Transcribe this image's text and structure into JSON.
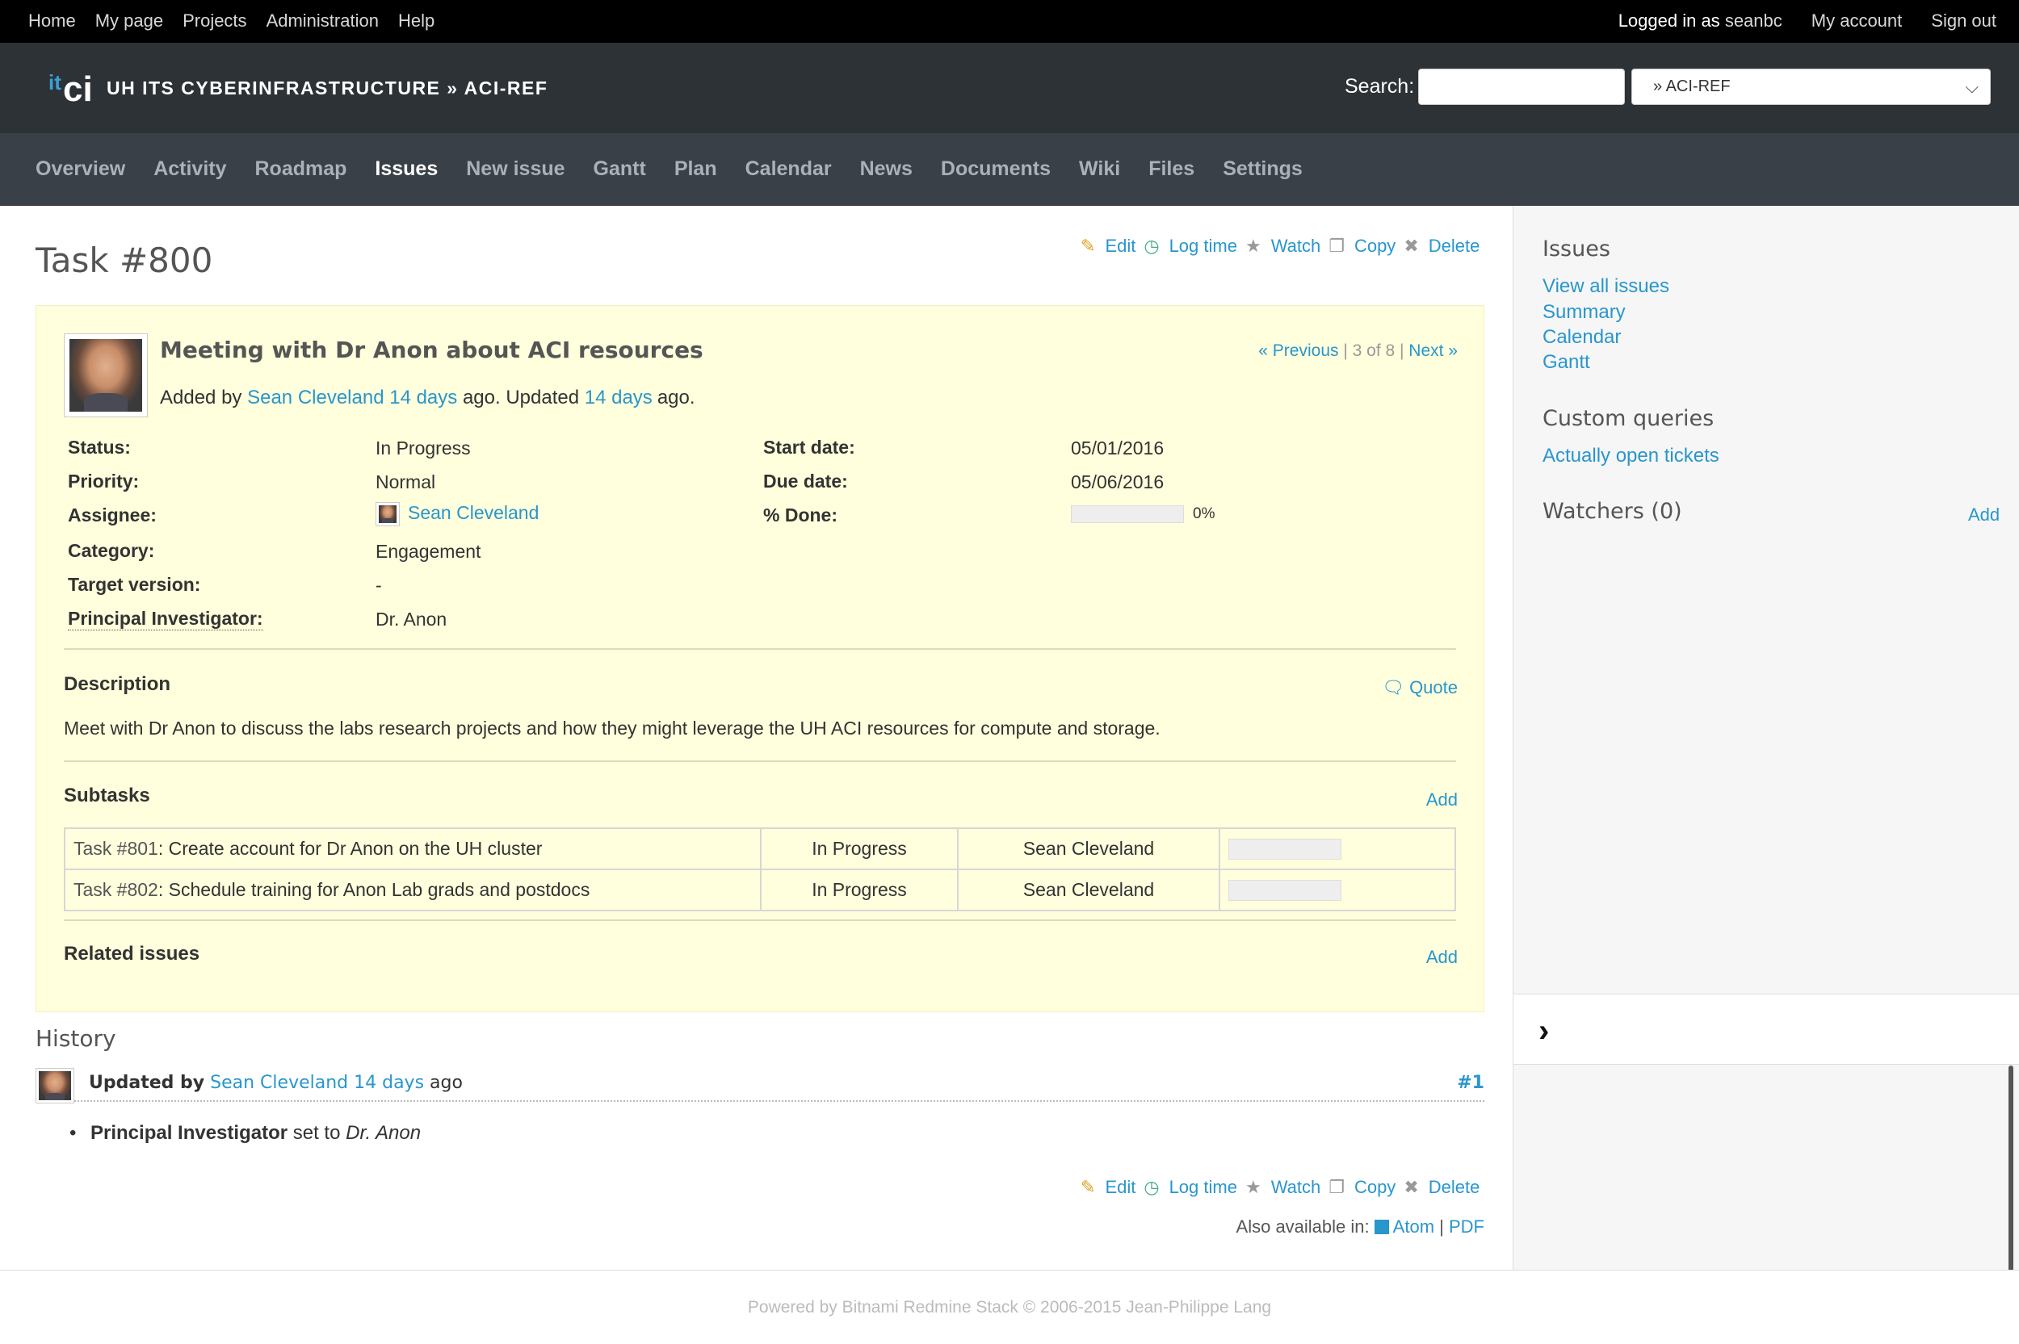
{
  "top_menu": {
    "items": [
      "Home",
      "My page",
      "Projects",
      "Administration",
      "Help"
    ],
    "logged_in_prefix": "Logged in as",
    "user": "seanbc",
    "my_account": "My account",
    "sign_out": "Sign out"
  },
  "header": {
    "logo_it": "it",
    "logo_ci": "ci",
    "title": "UH ITS CYBERINFRASTRUCTURE » ACI-REF",
    "search_label": "Search:",
    "search_value": "",
    "project_jump": "» ACI-REF"
  },
  "main_menu": {
    "tabs": [
      "Overview",
      "Activity",
      "Roadmap",
      "Issues",
      "New issue",
      "Gantt",
      "Plan",
      "Calendar",
      "News",
      "Documents",
      "Wiki",
      "Files",
      "Settings"
    ],
    "selected": "Issues"
  },
  "actions": {
    "edit": "Edit",
    "log_time": "Log time",
    "watch": "Watch",
    "copy": "Copy",
    "delete": "Delete"
  },
  "issue": {
    "title": "Task #800",
    "subject": "Meeting with Dr Anon about ACI resources",
    "added_by_prefix": "Added by",
    "author": "Sean Cleveland",
    "created_ago": "14 days",
    "updated_prefix": "ago. Updated",
    "updated_ago": "14 days",
    "updated_suffix": "ago.",
    "nav": {
      "previous": "« Previous",
      "position": "3 of 8",
      "next": "Next »"
    },
    "attributes": {
      "status_label": "Status:",
      "status": "In Progress",
      "priority_label": "Priority:",
      "priority": "Normal",
      "assignee_label": "Assignee:",
      "assignee": "Sean Cleveland",
      "category_label": "Category:",
      "category": "Engagement",
      "target_version_label": "Target version:",
      "target_version": "-",
      "pi_label": "Principal Investigator:",
      "pi": "Dr. Anon",
      "start_date_label": "Start date:",
      "start_date": "05/01/2016",
      "due_date_label": "Due date:",
      "due_date": "05/06/2016",
      "done_label": "% Done:",
      "done": "0%",
      "done_fraction": 0
    },
    "description_title": "Description",
    "quote": "Quote",
    "description": "Meet with Dr Anon to discuss the labs research projects and how they might leverage the UH ACI resources for compute and storage.",
    "subtasks_title": "Subtasks",
    "subtasks_add": "Add",
    "subtasks": [
      {
        "tracker": "Task #801",
        "subject": ": Create account for Dr Anon on the UH cluster",
        "status": "In Progress",
        "assignee": "Sean Cleveland",
        "done_fraction": 0
      },
      {
        "tracker": "Task #802",
        "subject": ": Schedule training for Anon Lab grads and postdocs",
        "status": "In Progress",
        "assignee": "Sean Cleveland",
        "done_fraction": 0
      }
    ],
    "related_title": "Related issues",
    "related_add": "Add"
  },
  "history": {
    "title": "History",
    "updated_by": "Updated by",
    "author": "Sean Cleveland",
    "ago": "14 days",
    "ago_suffix": "ago",
    "journal_num": "#1",
    "detail_field": "Principal Investigator",
    "detail_set_to": "set to",
    "detail_value": "Dr. Anon"
  },
  "other_formats": {
    "label": "Also available in:",
    "atom": "Atom",
    "sep": "|",
    "pdf": "PDF"
  },
  "sidebar": {
    "issues_title": "Issues",
    "issues_links": [
      "View all issues",
      "Summary",
      "Calendar",
      "Gantt"
    ],
    "queries_title": "Custom queries",
    "queries_links": [
      "Actually open tickets"
    ],
    "watchers_title": "Watchers (0)",
    "watchers_add": "Add"
  },
  "footer": {
    "text": "Powered by Bitnami Redmine Stack © 2006-2015 Jean-Philippe Lang"
  },
  "colors": {
    "link": "#2996cc",
    "issue_bg": "#ffffdd",
    "header_bg": "#2d3237",
    "menu_bg": "#3a4047"
  }
}
